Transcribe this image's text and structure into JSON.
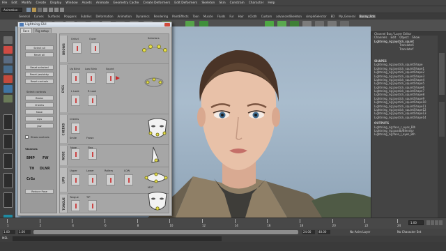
{
  "menubar": {
    "items": [
      "File",
      "Edit",
      "Modify",
      "Create",
      "Display",
      "Window",
      "Assets",
      "Animate",
      "Geometry Cache",
      "Create Deformers",
      "Edit Deformers",
      "Skeleton",
      "Skin",
      "Constrain",
      "Character",
      "Help"
    ]
  },
  "statusline": {
    "mode": "Animation"
  },
  "shelf": {
    "tabs": [
      "General",
      "Curves",
      "Surfaces",
      "Polygons",
      "Subdivs",
      "Deformation",
      "Animation",
      "Dynamics",
      "Rendering",
      "PaintEffects",
      "Toon",
      "Muscle",
      "Fluids",
      "Fur",
      "Hair",
      "nCloth",
      "Custom",
      "advancedSkeleton",
      "simpleSelector",
      "ED",
      "My_General",
      "Bunny_Rdn"
    ],
    "active_tab": "Bunny_Rdn",
    "icons": [
      "clusters",
      "blendshape",
      "lattice",
      "wrap",
      "smooth",
      "nurbs",
      "layer",
      "mirror",
      "cfg",
      "pose",
      "jnt",
      "joint",
      "lock",
      "pin",
      "lightning-a",
      "lightning-b",
      "mask",
      "key",
      "dot",
      "cube",
      "cam"
    ]
  },
  "gui": {
    "title": "Lightning GUI",
    "tabs": [
      "Face",
      "Rig setup"
    ],
    "active_tab": "Face",
    "left_buttons": [
      "Select all",
      "Reset all",
      "Reset selected",
      "Reset jawlobby",
      "Reset controls"
    ],
    "select_controls_label": "Select controls",
    "control_buttons": [
      "Brows",
      "Cheeks",
      "Nose",
      "Lips",
      "Jaw"
    ],
    "show_controls_label": "Show controls",
    "visemes_label": "Visemes",
    "visemes": [
      "BMP",
      "FW",
      "TH",
      "DLNR",
      "CrSz"
    ],
    "reduce_label": "Reduce Pose",
    "sections": [
      "BROWS",
      "EYES",
      "CHEEKS",
      "NOSE",
      "LIPS",
      "TONGUE"
    ],
    "sliders": {
      "brows": [
        "Unfurl",
        "Outer"
      ],
      "eyes": [
        "Up Blink",
        "Low Blink",
        "Squint",
        "L Look",
        "R Look"
      ],
      "cheeks": [
        "Cheeks",
        "Smile",
        "Frown"
      ],
      "nose": [
        "Nose",
        "Flex"
      ],
      "lips": [
        "Upper",
        "Lower",
        "Rollers",
        "LOW"
      ],
      "tongue": [
        "Tongue",
        "TIP"
      ]
    },
    "canvas_labels": [
      "Selectors",
      "MOT"
    ]
  },
  "viewport": {
    "frame": "persp"
  },
  "right_panel": {
    "header": "Channel Box / Layer Editor",
    "menu": [
      "Channels",
      "Edit",
      "Object",
      "Show"
    ],
    "object": "Lightning_rig:joystick_squint",
    "attrs": [
      "TranslateX",
      "TranslateY"
    ],
    "shapes_label": "SHAPES",
    "shapes": [
      "Lightning_rig:joystick_squintShape",
      "Lightning_rig:joystick_squintShape1",
      "Lightning_rig:joystick_squintShape2",
      "Lightning_rig:joystick_squintShape3",
      "Lightning_rig:joystick_squintShape4",
      "Lightning_rig:joystick_squintShape5",
      "Lightning_rig:joystick_squintShape6",
      "Lightning_rig:joystick_squintShape7",
      "Lightning_rig:joystick_squintShape8",
      "Lightning_rig:joystick_squintShape9",
      "Lightning_rig:joystick_squintShape10",
      "Lightning_rig:joystick_squintShape11",
      "Lightning_rig:joystick_squintShape12",
      "Lightning_rig:joystick_squintShape13",
      "Lightning_rig:joystick_squintShape14"
    ],
    "outputs_label": "OUTPUTS",
    "outputs": [
      "Lightning_rig:face_r_eyes_Blh",
      "Lightning_rig:pusdb/Blendsv",
      "Lightning_rig:face_l_eyes_Blh"
    ]
  },
  "timeline": {
    "ticks": [
      "1",
      "2",
      "4",
      "6",
      "8",
      "10",
      "12",
      "14",
      "16",
      "18",
      "20",
      "22",
      "24"
    ],
    "current": "1.00"
  },
  "range": {
    "start": "1.00",
    "start_inner": "1.00",
    "end_inner": "24.00",
    "end": "48.00",
    "anim_layer": "No Anim Layer",
    "char_set": "No Character Set"
  },
  "cmdline": {
    "label": "MEL"
  }
}
